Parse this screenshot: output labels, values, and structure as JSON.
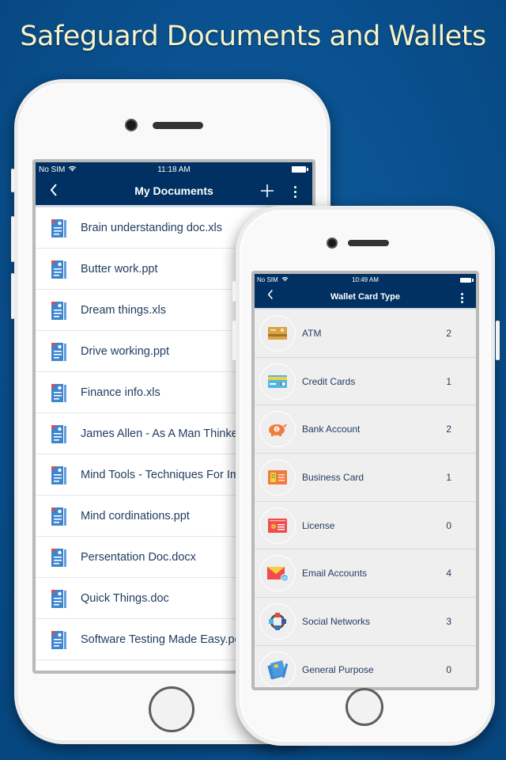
{
  "headline": "Safeguard Documents and Wallets",
  "colors": {
    "background": "#0a5190",
    "headline_text": "#f6f3c8",
    "navbar": "#003162",
    "list_text": "#1f3a5f",
    "doc_icon_blue": "#3d86cf",
    "doc_icon_corner": "#e54b4b"
  },
  "documents_screen": {
    "status_bar": {
      "carrier": "No SIM",
      "wifi_icon": "wifi-icon",
      "time": "11:18 AM",
      "battery_icon": "battery-icon"
    },
    "nav": {
      "back_icon": "chevron-left-icon",
      "title": "My Documents",
      "add_icon": "plus-icon",
      "more_icon": "more-vertical-icon"
    },
    "documents": [
      {
        "name": "Brain understanding doc.xls",
        "icon": "document-icon"
      },
      {
        "name": "Butter work.ppt",
        "icon": "document-icon"
      },
      {
        "name": "Dream things.xls",
        "icon": "document-icon"
      },
      {
        "name": "Drive working.ppt",
        "icon": "document-icon"
      },
      {
        "name": "Finance info.xls",
        "icon": "document-icon"
      },
      {
        "name": "James Allen - As A Man Thinke",
        "icon": "document-icon"
      },
      {
        "name": "Mind Tools - Techniques For Im",
        "icon": "document-icon"
      },
      {
        "name": "Mind cordinations.ppt",
        "icon": "document-icon"
      },
      {
        "name": "Persentation Doc.docx",
        "icon": "document-icon"
      },
      {
        "name": "Quick Things.doc",
        "icon": "document-icon"
      },
      {
        "name": "Software Testing Made Easy.pc",
        "icon": "document-icon"
      }
    ]
  },
  "wallet_screen": {
    "status_bar": {
      "carrier": "No SIM",
      "wifi_icon": "wifi-icon",
      "time": "10:49 AM",
      "battery_icon": "battery-icon"
    },
    "nav": {
      "back_icon": "chevron-left-icon",
      "title": "Wallet Card Type",
      "more_icon": "more-vertical-icon"
    },
    "card_types": [
      {
        "name": "ATM",
        "count": "2",
        "icon": "atm-card-icon"
      },
      {
        "name": "Credit Cards",
        "count": "1",
        "icon": "credit-card-icon"
      },
      {
        "name": "Bank Account",
        "count": "2",
        "icon": "piggy-bank-icon"
      },
      {
        "name": "Business Card",
        "count": "1",
        "icon": "business-card-icon"
      },
      {
        "name": "License",
        "count": "0",
        "icon": "license-icon"
      },
      {
        "name": "Email Accounts",
        "count": "4",
        "icon": "email-icon"
      },
      {
        "name": "Social Networks",
        "count": "3",
        "icon": "social-network-icon"
      },
      {
        "name": "General Purpose",
        "count": "0",
        "icon": "general-purpose-cards-icon"
      }
    ]
  }
}
